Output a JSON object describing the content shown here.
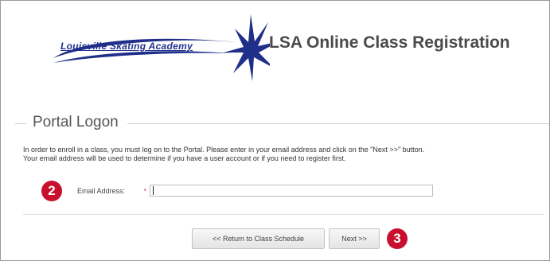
{
  "header": {
    "logo_text": "Louisville Skating Academy",
    "title": "LSA Online Class Registration"
  },
  "section": {
    "legend": "Portal Logon",
    "instructions_line1": "In order to enroll in a class, you must log on to the Portal. Please enter in your email address and click on the \"Next >>\" button.",
    "instructions_line2": "Your email address will be used to determine if you have a user account or if you need to register first."
  },
  "form": {
    "email_label": "Email Address:",
    "email_value": "",
    "required_mark": "•"
  },
  "buttons": {
    "return_label": "<< Return to Class Schedule",
    "next_label": "Next >>"
  },
  "callouts": {
    "step2": "2",
    "step3": "3"
  },
  "colors": {
    "logo_blue": "#1f2f8a",
    "callout_red": "#c8102e"
  }
}
